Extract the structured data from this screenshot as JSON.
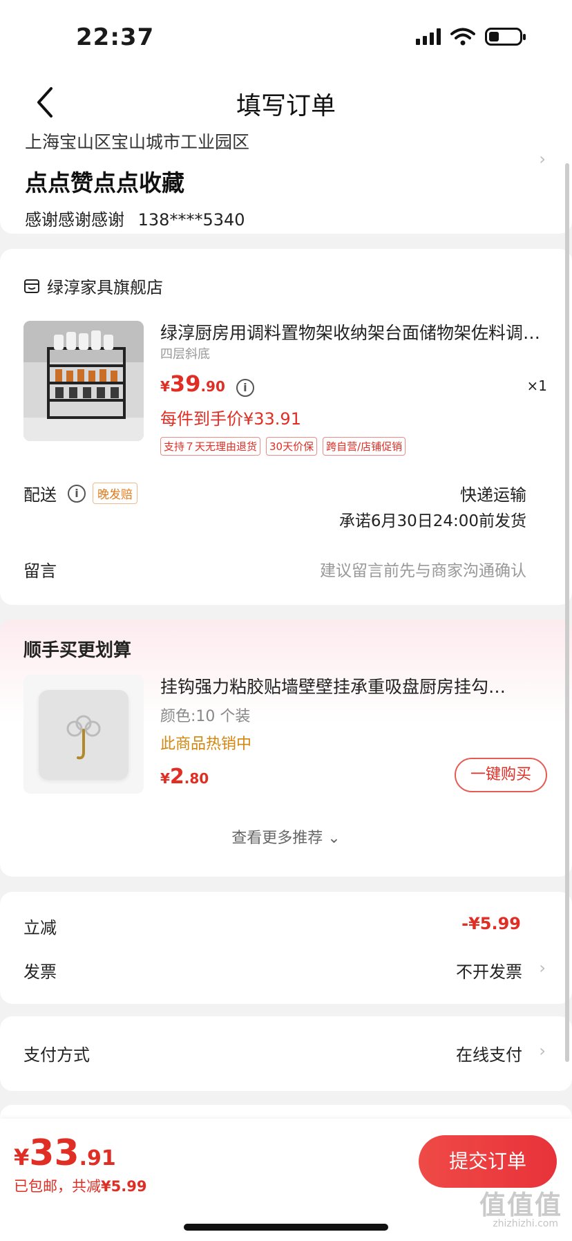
{
  "status_bar": {
    "time": "22:37"
  },
  "nav": {
    "title": "填写订单"
  },
  "address": {
    "region": "上海宝山区宝山城市工业园区",
    "detail": "点点赞点点收藏",
    "contact_name": "感谢感谢感谢",
    "contact_phone": "138****5340"
  },
  "store": {
    "name": "绿淳家具旗舰店",
    "product": {
      "title": "绿淳厨房用调料置物架收纳架台面储物架佐料调…",
      "spec": "四层斜底",
      "price_currency": "¥",
      "price_int": "39",
      "price_dec": ".90",
      "info_icon": "i",
      "quantity": "×1",
      "unit_price": "每件到手价¥33.91",
      "tags": [
        "支持７天无理由退货",
        "30天价保",
        "跨自营/店铺促销"
      ]
    },
    "shipping": {
      "label": "配送",
      "late_tag": "晚发赔",
      "method": "快递运输",
      "promise": "承诺6月30日24:00前发货"
    },
    "message": {
      "label": "留言",
      "placeholder": "建议留言前先与商家沟通确认"
    }
  },
  "recommend": {
    "title": "顺手买更划算",
    "item": {
      "name": "挂钩强力粘胶贴墙壁壁挂承重吸盘厨房挂勾…",
      "spec": "颜色:10 个装",
      "hot": "此商品热销中",
      "price_currency": "¥",
      "price_int": "2",
      "price_dec": ".80",
      "buy_label": "一键购买"
    },
    "more_label": "查看更多推荐 ⌄"
  },
  "summary": {
    "discount_label": "立减",
    "discount_value": "-¥5.99",
    "invoice_label": "发票",
    "invoice_value": "不开发票"
  },
  "payment": {
    "label": "支付方式",
    "value": "在线支付"
  },
  "footer": {
    "total_currency": "¥",
    "total_int": "33",
    "total_dec": ".91",
    "note_prefix": "已包邮，共减",
    "note_amount": "¥5.99",
    "submit_label": "提交订单"
  },
  "watermark": {
    "main": "值值值",
    "sub": "zhizhizhi.com"
  },
  "icons": {
    "chevron": "›"
  },
  "colors": {
    "accent": "#e02e24",
    "hot": "#d4860f",
    "submit": "#ef4a46"
  }
}
